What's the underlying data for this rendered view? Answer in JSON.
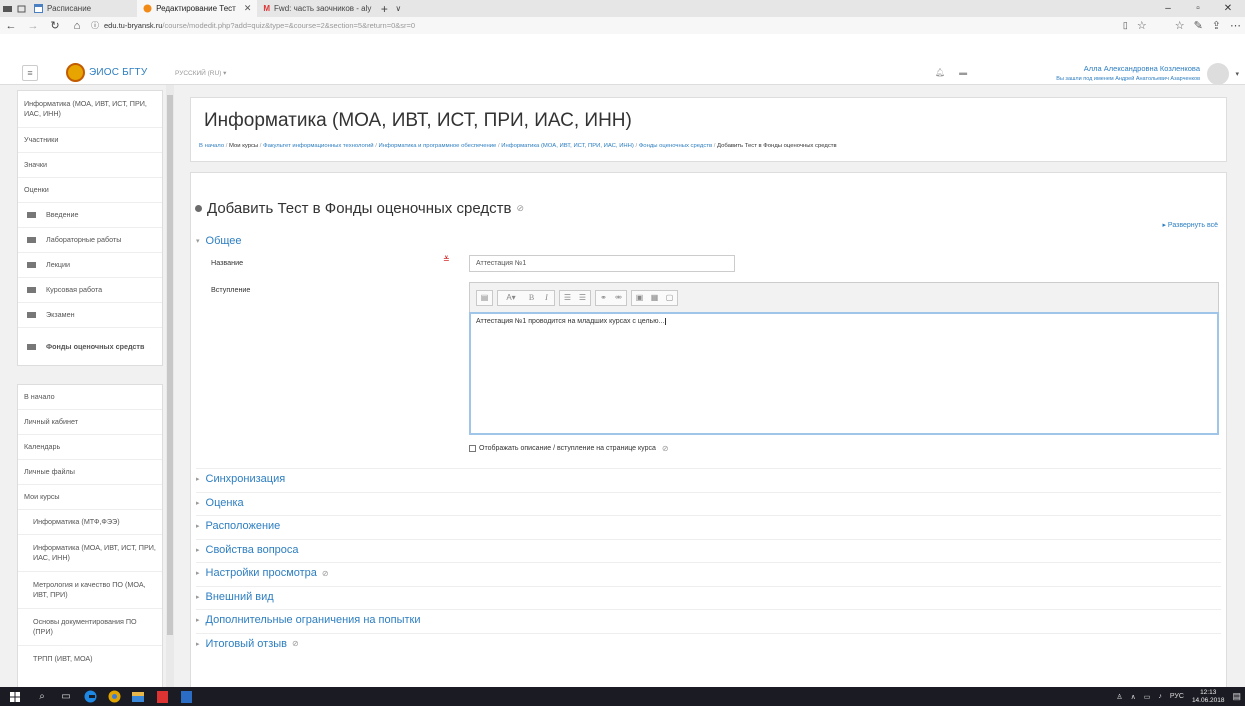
{
  "browser": {
    "tabs": [
      {
        "label": "Расписание",
        "active": false
      },
      {
        "label": "Редактирование Тест",
        "active": true
      },
      {
        "label": "Fwd: часть заочников - aly",
        "active": false
      }
    ],
    "url_host": "edu.tu-bryansk.ru",
    "url_path": "/course/modedit.php?add=quiz&type=&course=2&section=5&return=0&sr=0"
  },
  "navbar": {
    "brand": "ЭИОС БГТУ",
    "language": "РУССКИЙ (RU) ▾",
    "user_name": "Алла Александровна Козленкова",
    "user_sub": "Вы зашли под именем Андрей Анатольевич Азарченков"
  },
  "sidebar": {
    "course_block": [
      {
        "label": "Информатика (МОА, ИВТ, ИСТ, ПРИ, ИАС, ИНН)",
        "type": "tall"
      },
      {
        "label": "Участники",
        "type": "item"
      },
      {
        "label": "Значки",
        "type": "item"
      },
      {
        "label": "Оценки",
        "type": "item"
      },
      {
        "label": "Введение",
        "type": "folder"
      },
      {
        "label": "Лабораторные работы",
        "type": "folder"
      },
      {
        "label": "Лекции",
        "type": "folder"
      },
      {
        "label": "Курсовая работа",
        "type": "folder"
      },
      {
        "label": "Экзамен",
        "type": "folder"
      },
      {
        "label": "Фонды оценочных средств",
        "type": "folder-bold"
      }
    ],
    "nav_block": [
      {
        "label": "В начало",
        "type": "item"
      },
      {
        "label": "Личный кабинет",
        "type": "item"
      },
      {
        "label": "Календарь",
        "type": "item"
      },
      {
        "label": "Личные файлы",
        "type": "item"
      },
      {
        "label": "Мои курсы",
        "type": "item"
      },
      {
        "label": "Информатика (МТФ,ФЭЭ)",
        "type": "sub"
      },
      {
        "label": "Информатика (МОА, ИВТ, ИСТ, ПРИ, ИАС, ИНН)",
        "type": "sub-tall"
      },
      {
        "label": "Метрология и качество ПО (МОА, ИВТ, ПРИ)",
        "type": "sub-tall"
      },
      {
        "label": "Основы документирования ПО (ПРИ)",
        "type": "sub-tall"
      },
      {
        "label": "ТРПП (ИВТ, МОА)",
        "type": "sub"
      }
    ]
  },
  "header": {
    "title": "Информатика (МОА, ИВТ, ИСТ, ПРИ, ИАС, ИНН)",
    "breadcrumb": [
      {
        "label": "В начало",
        "link": true
      },
      {
        "label": "Мои курсы",
        "link": false
      },
      {
        "label": "Факультет информационных технологий",
        "link": true
      },
      {
        "label": "Информатика и программное обеспечение",
        "link": true
      },
      {
        "label": "Информатика (МОА, ИВТ, ИСТ, ПРИ, ИАС, ИНН)",
        "link": true
      },
      {
        "label": "Фонды оценочных средств",
        "link": true
      },
      {
        "label": "Добавить Тест в Фонды оценочных средств",
        "link": false
      }
    ]
  },
  "form": {
    "heading": "Добавить Тест в Фонды оценочных средств",
    "expand_all": "Развернуть всё",
    "general_section": "Общее",
    "name_label": "Название",
    "name_value": "Аттестация №1",
    "intro_label": "Вступление",
    "intro_text": "Аттестация №1 проводится на младших курсах с целью...",
    "show_description_label": "Отображать описание / вступление на странице курса",
    "sections": [
      "Синхронизация",
      "Оценка",
      "Расположение",
      "Свойства вопроса",
      "Настройки просмотра",
      "Внешний вид",
      "Дополнительные ограничения на попытки",
      "Итоговый отзыв"
    ]
  },
  "taskbar": {
    "lang": "РУС",
    "time": "12:13",
    "date": "14.06.2018"
  }
}
